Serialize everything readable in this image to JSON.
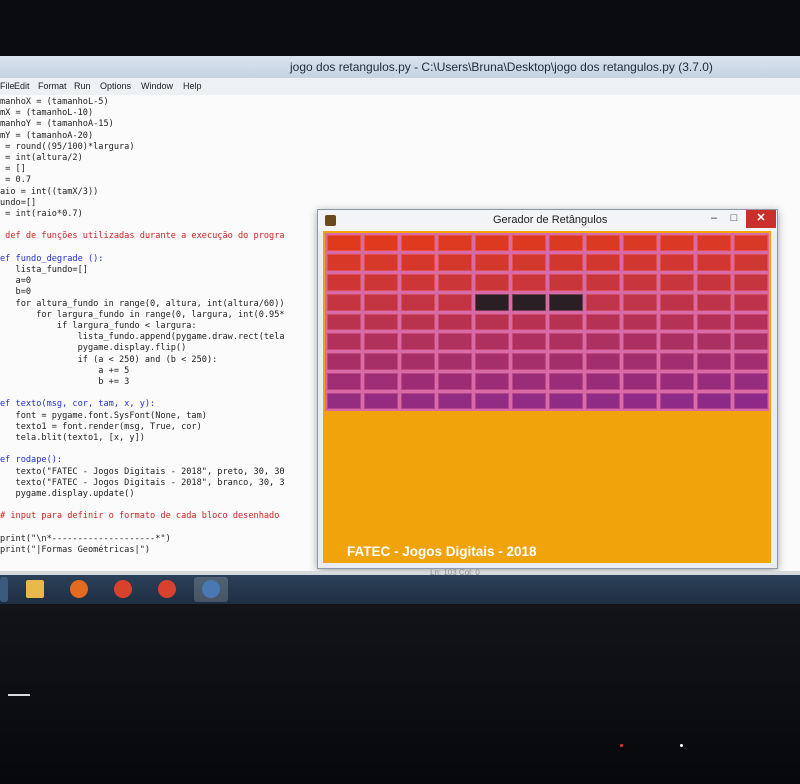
{
  "window": {
    "title": "jogo dos retangulos.py - C:\\Users\\Bruna\\Desktop\\jogo dos retangulos.py (3.7.0)"
  },
  "menu": [
    "File",
    "Edit",
    "Format",
    "Run",
    "Options",
    "Window",
    "Help"
  ],
  "code_lines": [
    {
      "text": "manhoX = (tamanhoL-5)"
    },
    {
      "text": "mX = (tamanhoL-10)"
    },
    {
      "text": "manhoY = (tamanhoA-15)"
    },
    {
      "text": "mY = (tamanhoA-20)"
    },
    {
      "text": " = round((95/100)*largura)"
    },
    {
      "text": " = int(altura/2)"
    },
    {
      "text": " = []"
    },
    {
      "text": " = 0.7"
    },
    {
      "text": "aio = int((tamX/3))"
    },
    {
      "text": "undo=[]"
    },
    {
      "text": " = int(raio*0.7)"
    },
    {
      "text": ""
    },
    {
      "text": " def de funções utilizadas durante a execução do progra",
      "cls": "cm"
    },
    {
      "text": ""
    },
    {
      "text": "ef fundo_degrade ():",
      "cls": "fn"
    },
    {
      "text": "   lista_fundo=[]"
    },
    {
      "text": "   a=0"
    },
    {
      "text": "   b=0"
    },
    {
      "text": "   for altura_fundo in range(0, altura, int(altura/60))"
    },
    {
      "text": "       for largura_fundo in range(0, largura, int(0.95*"
    },
    {
      "text": "           if largura_fundo < largura:"
    },
    {
      "text": "               lista_fundo.append(pygame.draw.rect(tela"
    },
    {
      "text": "               pygame.display.flip()"
    },
    {
      "text": "               if (a < 250) and (b < 250):"
    },
    {
      "text": "                   a += 5"
    },
    {
      "text": "                   b += 3"
    },
    {
      "text": ""
    },
    {
      "text": "ef texto(msg, cor, tam, x, y):",
      "cls": "fn"
    },
    {
      "text": "   font = pygame.font.SysFont(None, tam)"
    },
    {
      "text": "   texto1 = font.render(msg, True, cor)"
    },
    {
      "text": "   tela.blit(texto1, [x, y])"
    },
    {
      "text": ""
    },
    {
      "text": "ef rodape():",
      "cls": "fn"
    },
    {
      "text": "   texto(\"FATEC - Jogos Digitais - 2018\", preto, 30, 30"
    },
    {
      "text": "   texto(\"FATEC - Jogos Digitais - 2018\", branco, 30, 3"
    },
    {
      "text": "   pygame.display.update()"
    },
    {
      "text": ""
    },
    {
      "text": "# input para definir o formato de cada bloco desenhado",
      "cls": "cm"
    },
    {
      "text": ""
    },
    {
      "text": "print(\"\\n*--------------------*\")"
    },
    {
      "text": "print(\"|Formas Geométricas|\")"
    }
  ],
  "game_window": {
    "title": "Gerador de Retângulos",
    "minimize": "–",
    "maximize": "□",
    "close": "✕",
    "footer": "FATEC - Jogos Digitais - 2018",
    "colors": {
      "background": "#f0a30a",
      "brick_top": "#e03a1c",
      "brick_bottom": "#8c2a8a",
      "missing_brick": "#2a1f24"
    },
    "grid": {
      "rows": 9,
      "cols": 12,
      "missing": [
        [
          3,
          4
        ],
        [
          3,
          5
        ],
        [
          3,
          6
        ]
      ]
    }
  },
  "status_text": "Ln: 103 Col: 0",
  "taskbar": [
    {
      "name": "file-explorer-icon",
      "color": "#e8b94a"
    },
    {
      "name": "firefox-icon",
      "color": "#e36a1f"
    },
    {
      "name": "chrome-icon",
      "color": "#d9412f"
    },
    {
      "name": "chrome-icon",
      "color": "#d9412f"
    },
    {
      "name": "python-icon",
      "color": "#4a78b5"
    }
  ]
}
